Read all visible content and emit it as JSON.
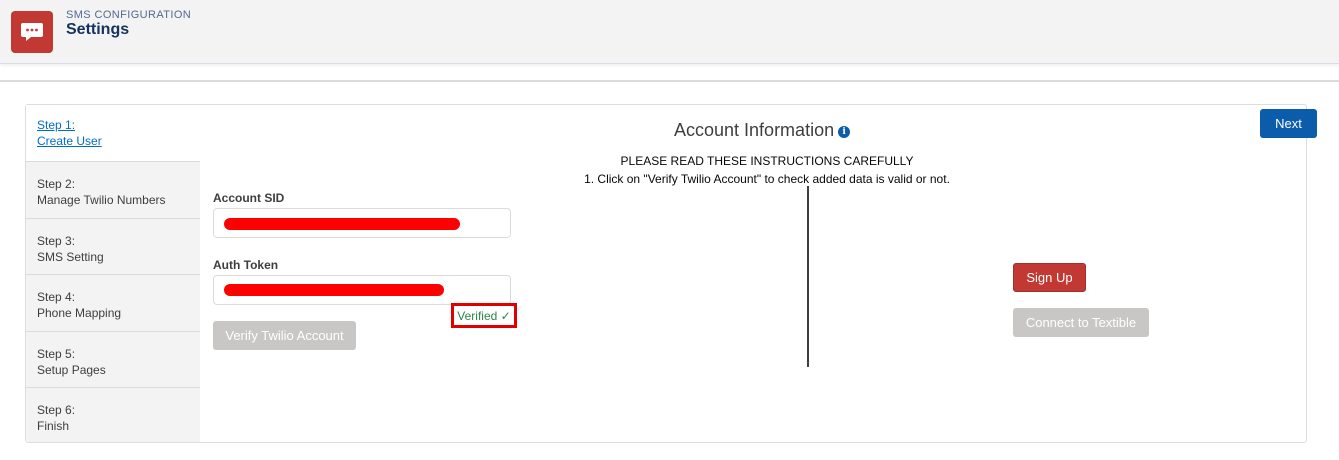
{
  "header": {
    "eyebrow": "SMS CONFIGURATION",
    "title": "Settings",
    "icon": "chat-bubble-icon",
    "accent": "#c23934"
  },
  "steps": [
    {
      "line1": "Step 1:",
      "line2": "Create User",
      "active": true
    },
    {
      "line1": "Step 2:",
      "line2": "Manage Twilio Numbers",
      "active": false
    },
    {
      "line1": "Step 3:",
      "line2": "SMS Setting",
      "active": false
    },
    {
      "line1": "Step 4:",
      "line2": "Phone Mapping",
      "active": false
    },
    {
      "line1": "Step 5:",
      "line2": "Setup Pages",
      "active": false
    },
    {
      "line1": "Step 6:",
      "line2": "Finish",
      "active": false
    }
  ],
  "main": {
    "title": "Account Information",
    "info_icon": "info-icon",
    "next_label": "Next",
    "instructions_heading": "PLEASE READ THESE INSTRUCTIONS CAREFULLY",
    "instructions": [
      "1. Click on \"Verify Twilio Account\" to check added data is valid or not."
    ],
    "account_sid_label": "Account SID",
    "auth_token_label": "Auth Token",
    "verified_text": "Verified ✓",
    "verify_button_label": "Verify Twilio Account",
    "signup_label": "Sign Up",
    "connect_label": "Connect to Textible"
  },
  "colors": {
    "primary": "#0b5cab",
    "danger": "#c23934",
    "disabled": "#c9c7c5",
    "success": "#2e844a",
    "redaction": "#ff0000"
  }
}
